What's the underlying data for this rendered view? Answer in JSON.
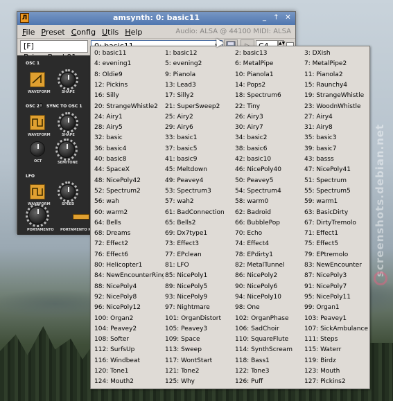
{
  "window": {
    "title": "amsynth: 0: basic11",
    "icon_glyph": "Л",
    "minimize_glyph": "_",
    "maximize_glyph": "↑",
    "close_glyph": "✕"
  },
  "menu": {
    "items": [
      "File",
      "Preset",
      "Config",
      "Utils",
      "Help"
    ]
  },
  "audio_info": "Audio: ALSA @ 44100   MIDI: ALSA",
  "toolbar": {
    "bank": "[F] BriansBank01",
    "preset": "0: basic11",
    "preset_arrow": "▼",
    "play_glyph": "▷",
    "note": "C4",
    "spin_glyph": "▲▼"
  },
  "synth": {
    "osc1_label": "OSC 1",
    "osc2_label": "OSC 2",
    "sync_label": "SYNC TO OSC 1",
    "lfo_label": "LFO",
    "waveform_label": "WAVEFORM",
    "shape_label": "SHAPE",
    "oct_label": "OCT",
    "semitone_label": "SEMITONE",
    "speed_label": "SPEED",
    "portamento_label": "PORTAMENTO",
    "portamento_mode_label": "PORTAMENTO M"
  },
  "presets": [
    "0: basic11",
    "1: basic12",
    "2: basic13",
    "3: DXish",
    "4: evening1",
    "5: evening2",
    "6: MetalPipe",
    "7: MetalPipe2",
    "8: Oldie9",
    "9: Pianola",
    "10: Pianola1",
    "11: Pianola2",
    "12: Pickins",
    "13: Lead3",
    "14: Pops2",
    "15: Raunchy4",
    "16: Silly",
    "17: Silly2",
    "18: Spectrum6",
    "19: StrangeWhistle",
    "20: StrangeWhistle2",
    "21: SuperSweep2",
    "22: Tiny",
    "23: WoodnWhistle",
    "24: Airy1",
    "25: Airy2",
    "26: Airy3",
    "27: Airy4",
    "28: Airy5",
    "29: Airy6",
    "30: Airy7",
    "31: Airy8",
    "32: basic",
    "33: basic1",
    "34: basic2",
    "35: basic3",
    "36: basic4",
    "37: basic5",
    "38: basic6",
    "39: basic7",
    "40: basic8",
    "41: basic9",
    "42: basic10",
    "43: basss",
    "44: SpaceX",
    "45: Meltdown",
    "46: NicePoly40",
    "47: NicePoly41",
    "48: NicePoly42",
    "49: Peavey4",
    "50: Peavey5",
    "51: Spectrum",
    "52: Spectrum2",
    "53: Spectrum3",
    "54: Spectrum4",
    "55: Spectrum5",
    "56: wah",
    "57: wah2",
    "58: warm0",
    "59: warm1",
    "60: warm2",
    "61: BadConnection",
    "62: Badroid",
    "63: BasicDirty",
    "64: Bells",
    "65: Bells2",
    "66: BubblePop",
    "67: DirtyTremolo",
    "68: Dreams",
    "69: Dx7type1",
    "70: Echo",
    "71: Effect1",
    "72: Effect2",
    "73: Effect3",
    "74: Effect4",
    "75: Effect5",
    "76: Effect6",
    "77: EPclean",
    "78: EPdirty1",
    "79: EPtremolo",
    "80: Helicopter1",
    "81: LFO",
    "82: MetalTunnel",
    "83: NewEncounter",
    "84: NewEncounterRing",
    "85: NicePoly1",
    "86: NicePoly2",
    "87: NicePoly3",
    "88: NicePoly4",
    "89: NicePoly5",
    "90: NicePoly6",
    "91: NicePoly7",
    "92: NicePoly8",
    "93: NicePoly9",
    "94: NicePoly10",
    "95: NicePoly11",
    "96: NicePoly12",
    "97: Nightmare",
    "98: One",
    "99: Organ1",
    "100: Organ2",
    "101: OrganDistort",
    "102: OrganPhase",
    "103: Peavey1",
    "104: Peavey2",
    "105: Peavey3",
    "106: SadChoir",
    "107: SickAmbulance",
    "108: Softer",
    "109: Space",
    "110: SquareFlute",
    "111: Steps",
    "112: SurfsUp",
    "113: Sweep",
    "114: SynthScream",
    "115: Waterr",
    "116: Windbeat",
    "117: WontStart",
    "118: Bass1",
    "119: Birdz",
    "120: Tone1",
    "121: Tone2",
    "122: Tone3",
    "123: Mouth",
    "124: Mouth2",
    "125: Why",
    "126: Puff",
    "127: Pickins2"
  ],
  "watermark": "screenshots.debian.net"
}
